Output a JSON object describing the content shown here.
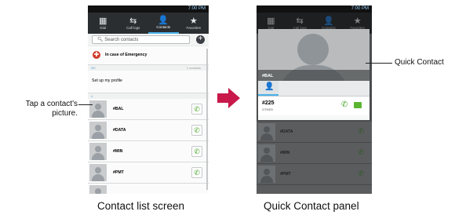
{
  "left_phone": {
    "status_time": "7:00 PM",
    "tabs": [
      {
        "icon": "dial-icon",
        "label": "Dial"
      },
      {
        "icon": "call-logs-icon",
        "label": "Call logs"
      },
      {
        "icon": "contacts-icon",
        "label": "Contacts"
      },
      {
        "icon": "favorites-icon",
        "label": "Favorites"
      }
    ],
    "search_placeholder": "Search contacts",
    "emergency": "In case of Emergency",
    "me_header": "ME",
    "me_count": "1 contacts",
    "profile": "Set up my profile",
    "section_letter": "#",
    "contacts": [
      "#BAL",
      "#DATA",
      "#MIN",
      "#PMT"
    ]
  },
  "right_phone": {
    "status_time": "7:00 PM",
    "tabs": [
      {
        "icon": "dial-icon",
        "label": "Dial"
      },
      {
        "icon": "call-logs-icon",
        "label": "Call logs"
      },
      {
        "icon": "contacts-icon",
        "label": "Contacts"
      },
      {
        "icon": "favorites-icon",
        "label": "Favorites"
      }
    ],
    "contact_name_overlay": "#BAL",
    "number": "#225",
    "number_type": "OTHER",
    "dim_contacts": [
      "#DATA",
      "#MIN",
      "#PMT"
    ]
  },
  "annotations": {
    "tap_picture_line1": "Tap a contact's",
    "tap_picture_line2": "picture.",
    "quick_contact": "Quick Contact"
  },
  "captions": {
    "left": "Contact list screen",
    "right": "Quick Contact panel"
  },
  "colors": {
    "accent": "#49b2e8",
    "arrow": "#c8194a",
    "call_green": "#4aa62a"
  }
}
